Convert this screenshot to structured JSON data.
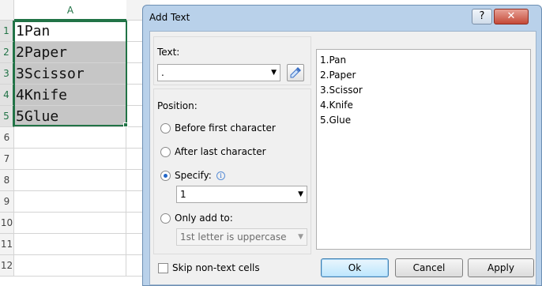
{
  "sheet": {
    "column_header": "A",
    "rows": [
      {
        "num": "1",
        "value": "1Pan"
      },
      {
        "num": "2",
        "value": "2Paper"
      },
      {
        "num": "3",
        "value": "3Scissor"
      },
      {
        "num": "4",
        "value": "4Knife"
      },
      {
        "num": "5",
        "value": "5Glue"
      },
      {
        "num": "6",
        "value": ""
      },
      {
        "num": "7",
        "value": ""
      },
      {
        "num": "8",
        "value": ""
      },
      {
        "num": "9",
        "value": ""
      },
      {
        "num": "10",
        "value": ""
      },
      {
        "num": "11",
        "value": ""
      },
      {
        "num": "12",
        "value": ""
      }
    ]
  },
  "dialog": {
    "title": "Add Text",
    "help_label": "?",
    "close_label": "✕",
    "text_label": "Text:",
    "text_value": ".",
    "position_label": "Position:",
    "options": {
      "before_first": "Before first character",
      "after_last": "After last character",
      "specify": "Specify:",
      "only_add_to": "Only add to:"
    },
    "selected_option": "specify",
    "specify_value": "1",
    "only_add_to_value": "1st letter is uppercase",
    "skip_label": "Skip non-text cells",
    "preview": [
      "1.Pan",
      "2.Paper",
      "3.Scissor",
      "4.Knife",
      "5.Glue"
    ],
    "buttons": {
      "ok": "Ok",
      "cancel": "Cancel",
      "apply": "Apply"
    }
  }
}
